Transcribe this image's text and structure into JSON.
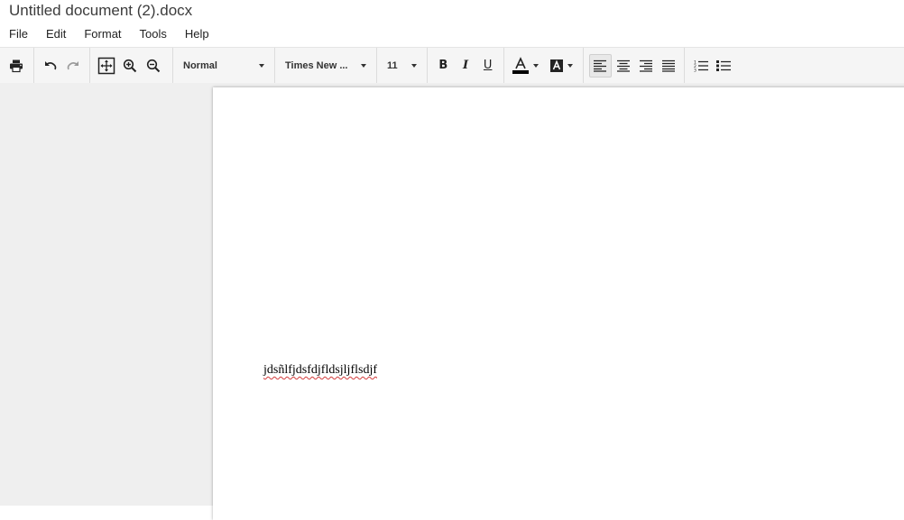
{
  "window": {
    "title": "Untitled document (2).docx"
  },
  "menubar": {
    "items": [
      {
        "label": "File"
      },
      {
        "label": "Edit"
      },
      {
        "label": "Format"
      },
      {
        "label": "Tools"
      },
      {
        "label": "Help"
      }
    ]
  },
  "toolbar": {
    "print_icon": "printer-icon",
    "undo_icon": "undo-icon",
    "redo_icon": "redo-icon",
    "fit_icon": "fit-page-icon",
    "zoom_in_icon": "zoom-in-icon",
    "zoom_out_icon": "zoom-out-icon",
    "paragraph_style": "Normal",
    "font_family": "Times New ...",
    "font_size": "11",
    "bold_label": "B",
    "italic_label": "I",
    "underline_label": "U",
    "text_color": "#000000",
    "highlight_icon": "highlight-color-icon",
    "align_left_active": true,
    "align_icons": [
      "align-left-icon",
      "align-center-icon",
      "align-right-icon",
      "align-justify-icon"
    ],
    "list_icons": [
      "numbered-list-icon",
      "bulleted-list-icon"
    ]
  },
  "document": {
    "text": "jdsñlfjdsfdjfldsjljflsdjf",
    "spellcheck_color": "#d23b3b"
  }
}
